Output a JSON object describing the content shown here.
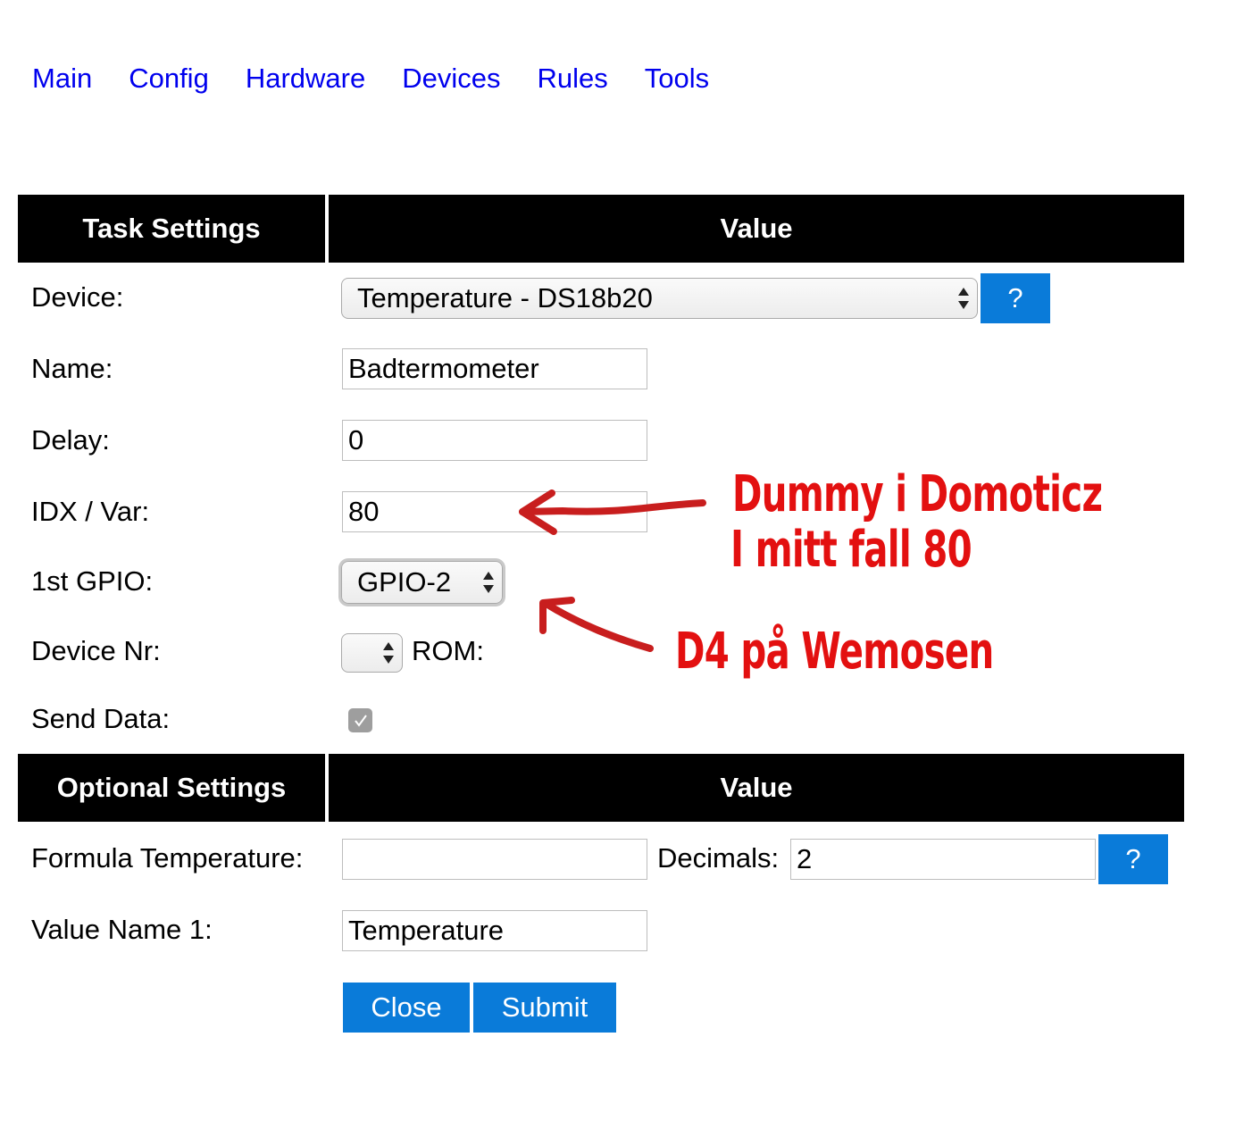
{
  "nav": {
    "items": [
      "Main",
      "Config",
      "Hardware",
      "Devices",
      "Rules",
      "Tools"
    ]
  },
  "task_table": {
    "header_left": "Task Settings",
    "header_right": "Value",
    "device_label": "Device:",
    "device_value": "Temperature - DS18b20",
    "help_label": "?",
    "name_label": "Name:",
    "name_value": "Badtermometer",
    "delay_label": "Delay:",
    "delay_value": "0",
    "idx_label": "IDX / Var:",
    "idx_value": "80",
    "gpio_label": "1st GPIO:",
    "gpio_value": "GPIO-2",
    "device_nr_label": "Device Nr:",
    "device_nr_value": "",
    "rom_label": "ROM:",
    "send_data_label": "Send Data:",
    "send_data_checked": true
  },
  "optional_table": {
    "header_left": "Optional Settings",
    "header_right": "Value",
    "formula_label": "Formula Temperature:",
    "formula_value": "",
    "decimals_label": "Decimals:",
    "decimals_value": "2",
    "help_label": "?",
    "value_name_label": "Value Name 1:",
    "value_name_value": "Temperature"
  },
  "buttons": {
    "close": "Close",
    "submit": "Submit"
  },
  "annotations": {
    "idx_note_line1": "Dummy i Domoticz",
    "idx_note_line2": "I mitt fall 80",
    "gpio_note": "D4 på Wemosen",
    "color": "#e31010"
  },
  "colors": {
    "link": "#0000ee",
    "header_bg": "#000000",
    "button": "#0a7bd9"
  }
}
